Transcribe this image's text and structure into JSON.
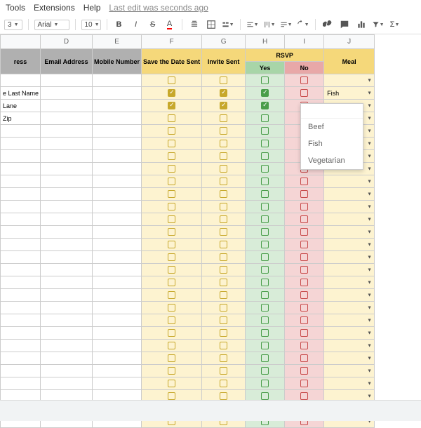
{
  "menu": {
    "tools": "Tools",
    "extensions": "Extensions",
    "help": "Help",
    "last_edit": "Last edit was seconds ago"
  },
  "toolbar": {
    "font": "Arial",
    "size": "10",
    "zoom": "3"
  },
  "colheads": [
    "",
    "D",
    "E",
    "F",
    "G",
    "H",
    "I",
    "J"
  ],
  "headers": {
    "address": "ress",
    "email": "Email Address",
    "mobile": "Mobile Number",
    "savedate": "Save the Date Sent",
    "invite": "Invite Sent",
    "rsvp": "RSVP",
    "yes": "Yes",
    "no": "No",
    "meal": "Meal"
  },
  "rows": [
    {
      "c": "",
      "sd": false,
      "iv": false,
      "y": false,
      "n": false,
      "meal": ""
    },
    {
      "c": "e Last Name",
      "sd": true,
      "iv": true,
      "y": true,
      "n": false,
      "meal": "Fish"
    },
    {
      "c": "Lane",
      "sd": true,
      "iv": true,
      "y": true,
      "n": false,
      "meal": ""
    },
    {
      "c": "Zip",
      "sd": false,
      "iv": false,
      "y": false,
      "n": false,
      "meal": ""
    }
  ],
  "blank_rows": 24,
  "dropdown": {
    "search": "",
    "options": [
      "Beef",
      "Fish",
      "Vegetarian"
    ]
  }
}
